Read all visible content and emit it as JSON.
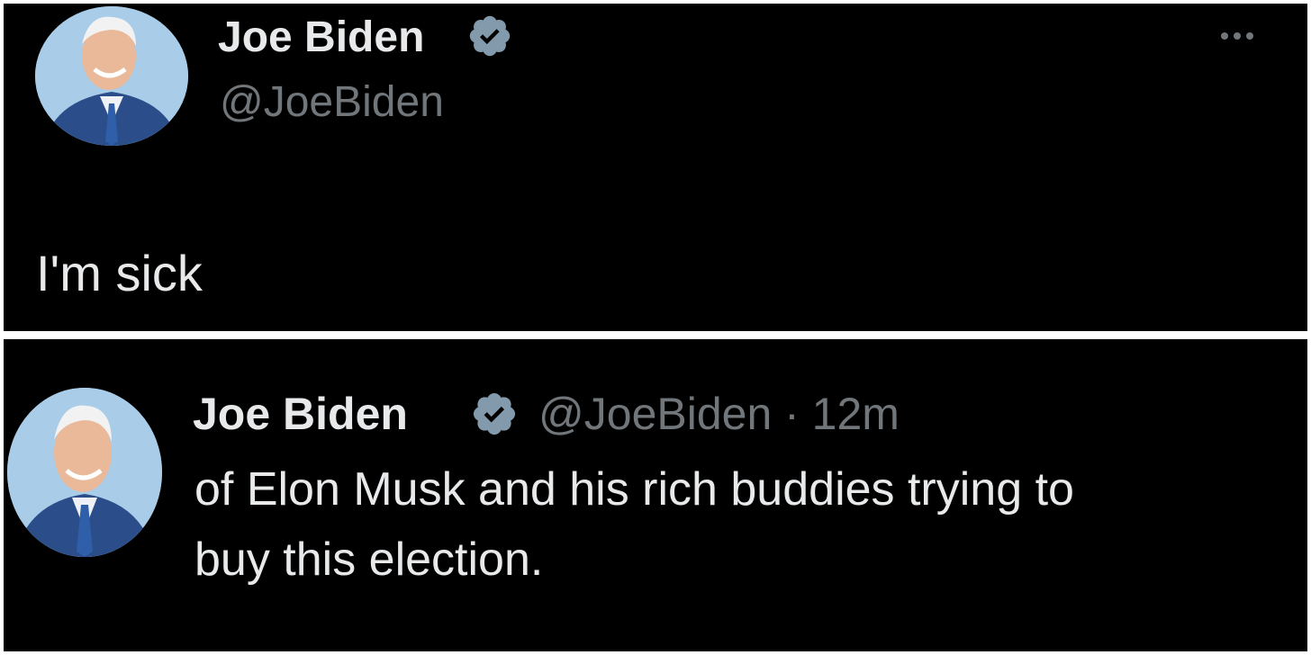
{
  "tweet_top": {
    "name": "Joe Biden",
    "handle": "@JoeBiden",
    "text": "I'm sick",
    "more_icon": "more-horizontal-icon",
    "badge_icon": "verified-badge-icon",
    "avatar_icon": "profile-photo"
  },
  "tweet_bottom": {
    "name": "Joe Biden",
    "handle_meta": "@JoeBiden · 12m",
    "text_line1": "of Elon Musk and his rich buddies trying to",
    "text_line2": "buy this election.",
    "badge_icon": "verified-badge-icon",
    "avatar_icon": "profile-photo"
  },
  "colors": {
    "background": "#000000",
    "text_primary": "#e7e9ea",
    "text_secondary": "#71767b",
    "verified_badge": "#829aab"
  }
}
